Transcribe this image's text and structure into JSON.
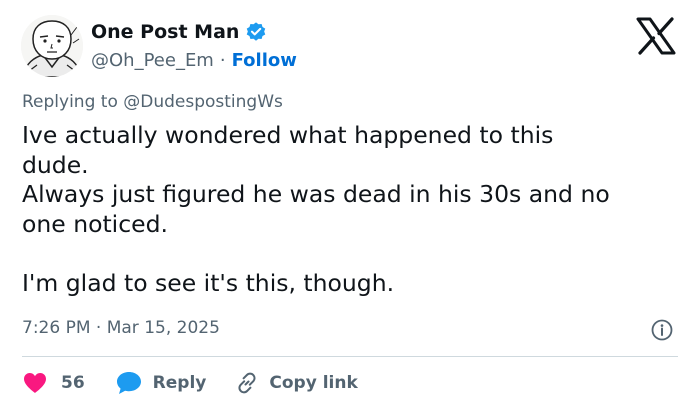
{
  "author": {
    "name": "One Post Man",
    "handle": "@Oh_Pee_Em",
    "separator": "·",
    "follow_label": "Follow",
    "avatar": "avatar-icon",
    "verified": "verified-badge-icon"
  },
  "brand": {
    "logo": "x-logo-icon"
  },
  "reply_context": "Replying to @DudespostingWs",
  "tweet": {
    "lines": [
      "Ive actually wondered what happened to this",
      "dude.",
      "Always just figured he was dead in his 30s and no",
      "one noticed.",
      "",
      "I'm glad to see it's this, though."
    ]
  },
  "timestamp": "7:26 PM · Mar 15, 2025",
  "actions": {
    "like_count": "56",
    "reply_label": "Reply",
    "copy_link_label": "Copy link"
  },
  "colors": {
    "text": "#0f1419",
    "secondary": "#536471",
    "link": "#006fd6",
    "verified": "#1d9bf0",
    "like": "#f91880",
    "reply": "#1d9bf0",
    "divider": "#cfd9de"
  }
}
